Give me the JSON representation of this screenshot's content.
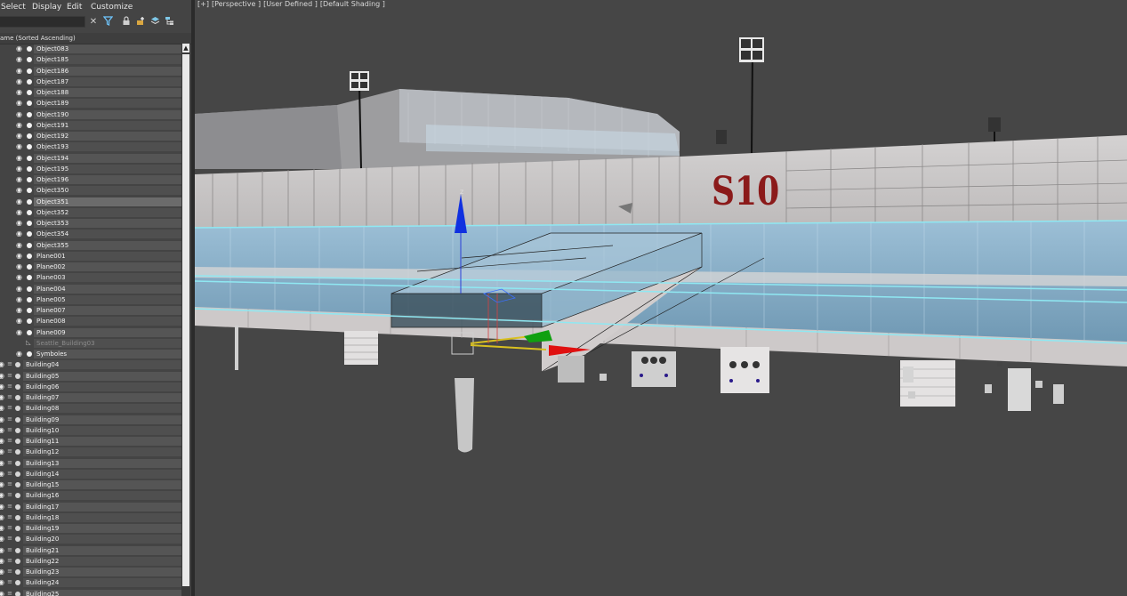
{
  "menu": [
    "Select",
    "Display",
    "Edit",
    "Customize"
  ],
  "search": {
    "value": ""
  },
  "toolbar_icons": [
    "clear-icon",
    "filter-icon",
    "lock-icon",
    "add-layer-icon",
    "layers-icon",
    "hierarchy-icon"
  ],
  "column_header": "ame (Sorted Ascending)",
  "objects": [
    {
      "label": "Object083"
    },
    {
      "label": "Object185"
    },
    {
      "label": "Object186"
    },
    {
      "label": "Object187"
    },
    {
      "label": "Object188"
    },
    {
      "label": "Object189"
    },
    {
      "label": "Object190"
    },
    {
      "label": "Object191"
    },
    {
      "label": "Object192"
    },
    {
      "label": "Object193"
    },
    {
      "label": "Object194"
    },
    {
      "label": "Object195"
    },
    {
      "label": "Object196"
    },
    {
      "label": "Object350"
    },
    {
      "label": "Object351",
      "selected": true
    },
    {
      "label": "Object352"
    },
    {
      "label": "Object353"
    },
    {
      "label": "Object354"
    },
    {
      "label": "Object355"
    },
    {
      "label": "Plane001"
    },
    {
      "label": "Plane002"
    },
    {
      "label": "Plane003"
    },
    {
      "label": "Plane004"
    },
    {
      "label": "Plane005"
    },
    {
      "label": "Plane007"
    },
    {
      "label": "Plane008"
    },
    {
      "label": "Plane009"
    },
    {
      "label": "Seattle_Building03",
      "dim": true
    },
    {
      "label": "Symboles"
    }
  ],
  "buildings": [
    "Building04",
    "Building05",
    "Building06",
    "Building07",
    "Building08",
    "Building09",
    "Building10",
    "Building11",
    "Building12",
    "Building13",
    "Building14",
    "Building15",
    "Building16",
    "Building17",
    "Building18",
    "Building19",
    "Building20",
    "Building21",
    "Building22",
    "Building23",
    "Building24",
    "Building25"
  ],
  "viewport": {
    "labels": [
      "[+]",
      "[Perspective ]",
      "[User Defined ]",
      "[Default Shading ]"
    ],
    "sign_text": "S10",
    "gizmo_axis_z": "z"
  },
  "colors": {
    "background": "#444444",
    "selection_outline": "#8fe8f2",
    "gizmo_x": "#e01010",
    "gizmo_y": "#10a010",
    "gizmo_z": "#1030e0",
    "sign": "#8b1a1a"
  }
}
